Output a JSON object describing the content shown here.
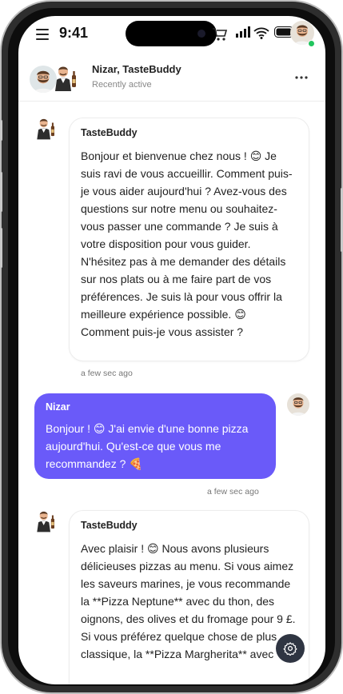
{
  "status_bar": {
    "time": "9:41"
  },
  "header": {
    "title": "Nizar, TasteBuddy",
    "status": "Recently active",
    "more_label": "..."
  },
  "messages": [
    {
      "sender": "TasteBuddy",
      "text": "Bonjour et bienvenue chez nous ! 😊 Je suis ravi de vous accueillir. Comment puis-je vous aider aujourd'hui ? Avez-vous des questions sur notre menu ou souhaitez-vous passer une commande ? Je suis à votre disposition pour vous guider. N'hésitez pas à me demander des détails sur nos plats ou à me faire part de vos préférences. Je suis là pour vous offrir la meilleure expérience possible. 😊 Comment puis-je vous assister ?",
      "time": "a few sec ago"
    },
    {
      "sender": "Nizar",
      "text": "Bonjour ! 😊 J'ai envie d'une bonne pizza aujourd'hui. Qu'est-ce que vous me recommandez ? 🍕",
      "time": "a few sec ago"
    },
    {
      "sender": "TasteBuddy",
      "text": "Avec plaisir ! 😊 Nous avons plusieurs délicieuses pizzas au menu. Si vous aimez les saveurs marines, je vous recommande la **Pizza Neptune** avec du thon, des oignons, des olives et du fromage pour 9 £. Si vous préférez quelque chose de plus classique, la **Pizza Margherita** avec"
    }
  ],
  "colors": {
    "accent": "#6a5af9",
    "fab": "#2f3542",
    "online": "#22c55e"
  },
  "icons": [
    "menu-icon",
    "cart-icon",
    "signal-icon",
    "wifi-icon",
    "battery-icon",
    "more-icon",
    "settings-icon"
  ]
}
